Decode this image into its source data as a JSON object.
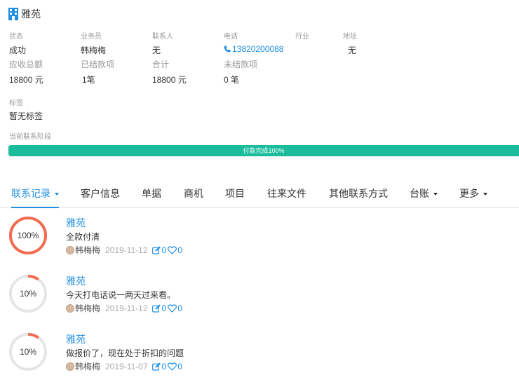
{
  "company": {
    "name": "雅苑"
  },
  "info": {
    "status_label": "状态",
    "status_value": "成功",
    "salesman_label": "业务员",
    "salesman_value": "韩梅梅",
    "contact_label": "联系人",
    "contact_value": "无",
    "phone_label": "电话",
    "phone_value": "13820200088",
    "industry_label": "行业",
    "address_label": "地址",
    "address_value": "无",
    "receivable_label": "应收总额",
    "receivable_value": "18800 元",
    "settled_label": "已结款项",
    "settled_value": "1笔",
    "total_label": "合计",
    "total_value": "18800 元",
    "unsettled_label": "未结款项",
    "unsettled_value": "0 笔",
    "tags_label": "标签",
    "tags_value": "暂无标签",
    "stage_label": "当前联系阶段"
  },
  "progress": {
    "label": "付款完成100%",
    "percent": 100,
    "color": "#1abc9c"
  },
  "tabs": [
    {
      "label": "联系记录",
      "caret": true,
      "active": true
    },
    {
      "label": "客户信息"
    },
    {
      "label": "单据"
    },
    {
      "label": "商机"
    },
    {
      "label": "项目"
    },
    {
      "label": "往来文件"
    },
    {
      "label": "其他联系方式"
    },
    {
      "label": "台账",
      "caret": true
    },
    {
      "label": "更多",
      "caret": true
    }
  ],
  "records": [
    {
      "percent_text": "100%",
      "percent": 100,
      "ring_color": "#f26b50",
      "title": "雅苑",
      "content": "全款付清",
      "author": "韩梅梅",
      "date": "2019-11-12",
      "edit_count": "0",
      "like_count": "0"
    },
    {
      "percent_text": "10%",
      "percent": 10,
      "ring_color": "#f26b50",
      "title": "雅苑",
      "content": "今天打电话说一两天过来看。",
      "author": "韩梅梅",
      "date": "2019-11-12",
      "edit_count": "0",
      "like_count": "0"
    },
    {
      "percent_text": "10%",
      "percent": 10,
      "ring_color": "#f26b50",
      "title": "雅苑",
      "content": "做报价了，现在处于折扣的问题",
      "author": "韩梅梅",
      "date": "2019-11-07",
      "edit_count": "0",
      "like_count": "0"
    }
  ],
  "colors": {
    "accent": "#1f8fe5",
    "ring_track": "#e6e6e6"
  }
}
